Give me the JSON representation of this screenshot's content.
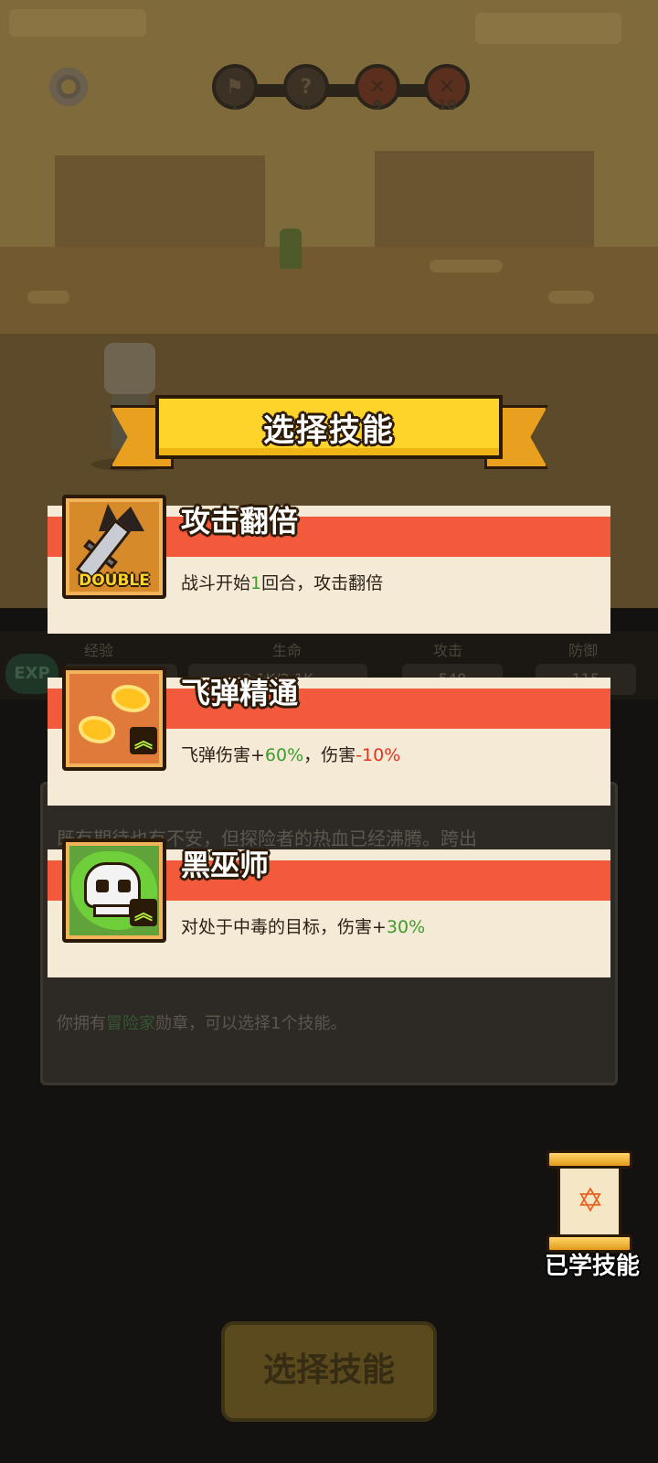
{
  "hud": {
    "stages": [
      {
        "num": "1",
        "icon": "flag-icon"
      },
      {
        "num": "8",
        "icon": "question-icon"
      },
      {
        "num": "9",
        "icon": "crossed-swords-icon"
      },
      {
        "num": "10",
        "icon": "crossed-swords-icon"
      }
    ]
  },
  "stats": {
    "exp_badge": "EXP",
    "exp_label": "经验",
    "hp_label": "生命",
    "hp_value": "2.1K/2.1K",
    "atk_label": "攻击",
    "atk_value": "548",
    "def_label": "防御",
    "def_value": "115"
  },
  "story": {
    "line1": "既有期待也有不安，但探险者的热血已经沸腾。跨出",
    "line3_prefix": "你拥有",
    "line3_highlight": "冒险家",
    "line3_suffix": "勋章，可以选择1个技能。"
  },
  "dialog": {
    "title": "选择技能",
    "skills": [
      {
        "name": "攻击翻倍",
        "icon": "double-sword-icon",
        "icon_badge": "DOUBLE",
        "desc_parts": [
          "战斗开始",
          "1",
          "回合，攻击翻倍"
        ]
      },
      {
        "name": "飞弹精通",
        "icon": "fireball-icon",
        "desc_parts": [
          "飞弹伤害+",
          "60%",
          "，伤害",
          "-10%"
        ]
      },
      {
        "name": "黑巫师",
        "icon": "poison-skull-icon",
        "desc_parts": [
          "对处于中毒的目标，伤害+",
          "30%"
        ]
      }
    ]
  },
  "learned_skills_label": "已学技能",
  "select_button_label": "选择技能",
  "colors": {
    "banner_yellow": "#ffd42a",
    "card_red": "#f25a3b",
    "card_cream": "#f5ead6",
    "positive_green": "#3e9c2f",
    "negative_red": "#e2341f"
  }
}
